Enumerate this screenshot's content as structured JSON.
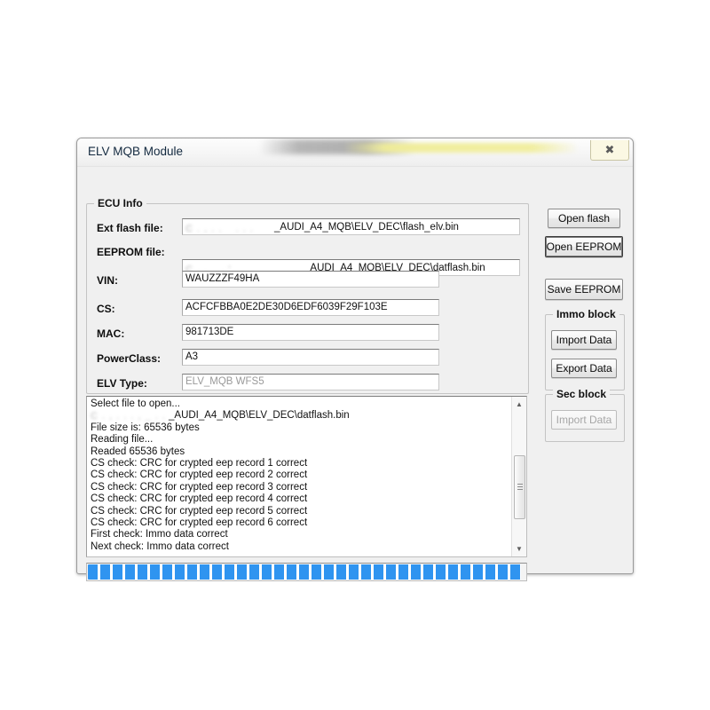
{
  "window": {
    "title": "ELV MQB Module",
    "close_label": "✖",
    "close_icon": "close-icon"
  },
  "ecu_info": {
    "title": "ECU Info",
    "fields": [
      {
        "label": "Ext flash file:",
        "value": "_AUDI_A4_MQB\\ELV_DEC\\flash_elv.bin",
        "redacted_prefix": "C . ,  . . _ . . .",
        "disabled": true
      },
      {
        "label": "EEPROM file:",
        "value": "_AUDI_A4_MQB\\ELV_DEC\\datflash.bin",
        "redacted_prefix": "C . , _ .  '",
        "disabled": true
      },
      {
        "label": "VIN:",
        "value": "WAUZZZF49HA",
        "disabled": false
      },
      {
        "label": "CS:",
        "value": "ACFCFBBA0E2DE30D6EDF6039F29F103E",
        "disabled": false
      },
      {
        "label": "MAC:",
        "value": "981713DE",
        "disabled": false
      },
      {
        "label": "PowerClass:",
        "value": "A3",
        "disabled": false
      },
      {
        "label": "ELV Type:",
        "value": "ELV_MQB WFS5",
        "disabled": true
      }
    ]
  },
  "actions": {
    "open_flash": "Open flash",
    "open_eeprom": "Open EEPROM",
    "save_eeprom": "Save EEPROM"
  },
  "immo_block": {
    "title": "Immo block",
    "import_label": "Import Data",
    "export_label": "Export Data"
  },
  "sec_block": {
    "title": "Sec block",
    "import_label": "Import Data"
  },
  "log": {
    "lines": [
      {
        "text": "Select file to open...",
        "redacted": false
      },
      {
        "text": "_AUDI_A4_MQB\\ELV_DEC\\datflash.bin",
        "redacted": true,
        "redacted_prefix": "C . ,  . . . , _ . . ."
      },
      {
        "text": "File size is: 65536 bytes",
        "redacted": false
      },
      {
        "text": "Reading file...",
        "redacted": false
      },
      {
        "text": "Readed 65536 bytes",
        "redacted": false
      },
      {
        "text": "CS check: CRC for crypted eep record 1 correct",
        "redacted": false
      },
      {
        "text": "CS check: CRC for crypted eep record 2 correct",
        "redacted": false
      },
      {
        "text": "CS check: CRC for crypted eep record 3 correct",
        "redacted": false
      },
      {
        "text": "CS check: CRC for crypted eep record 4 correct",
        "redacted": false
      },
      {
        "text": "CS check: CRC for crypted eep record 5 correct",
        "redacted": false
      },
      {
        "text": "CS check: CRC for crypted eep record 6 correct",
        "redacted": false
      },
      {
        "text": "First check: Immo data correct",
        "redacted": false
      },
      {
        "text": "Next check: Immo data correct",
        "redacted": false
      }
    ],
    "scroll_up_icon": "▲",
    "scroll_down_icon": "▼"
  },
  "progress": {
    "percent": 99,
    "color": "#2f94f0"
  }
}
